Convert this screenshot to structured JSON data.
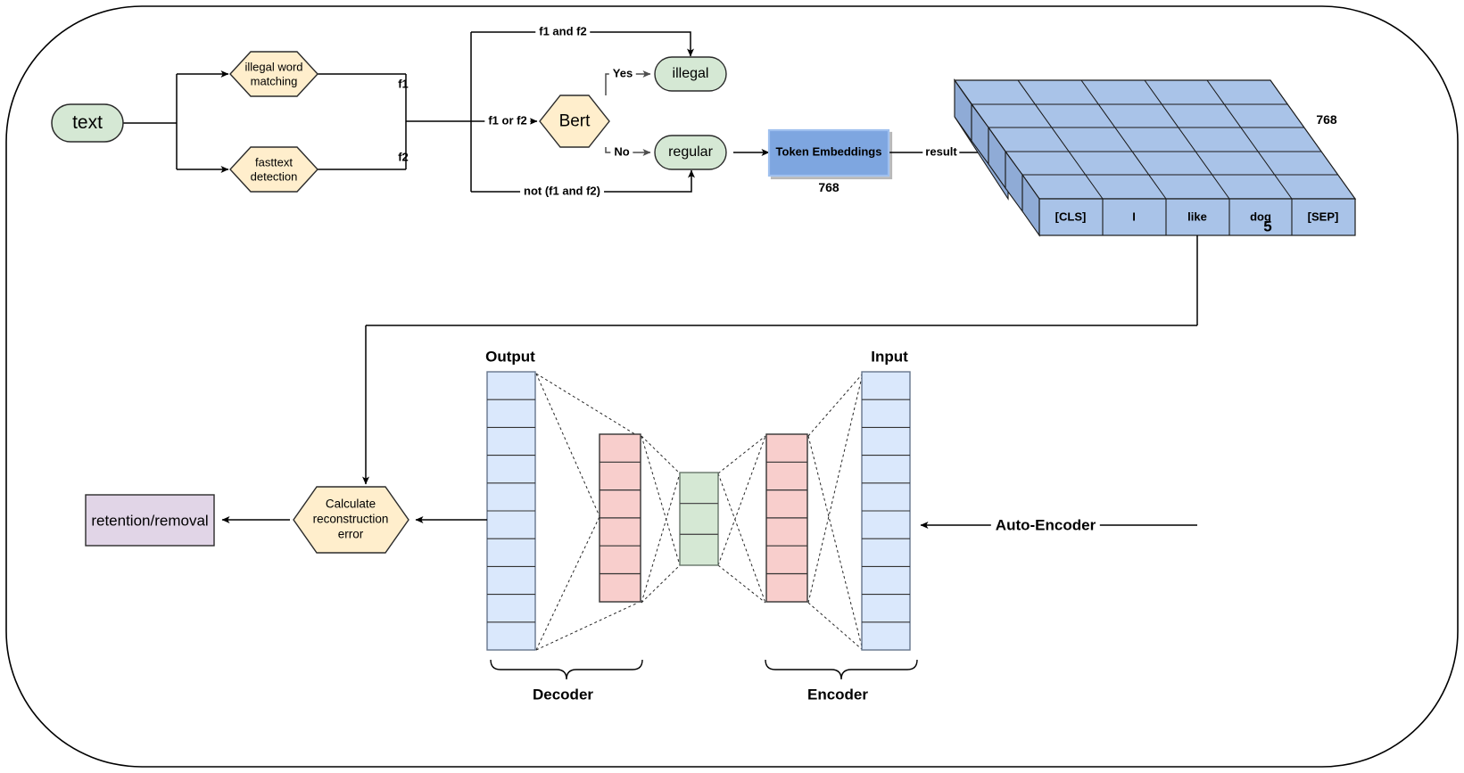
{
  "diagram": {
    "title": "Illegal text detection and auto-encoder pipeline",
    "colors": {
      "green_fill": "#d5e8d4",
      "green_stroke": "#82b366",
      "yellow_fill": "#ffe6cc",
      "yellow_stroke": "#d79b00",
      "blue_fill": "#dae8fc",
      "blue_stroke": "#6c8ebf",
      "blue_strong_fill": "#7ea6e0",
      "pink_fill": "#f8cecc",
      "pink_stroke": "#b85450",
      "purple_fill": "#e1d5e7",
      "purple_stroke": "#9673a6",
      "cube_fill": "#9cb9e0",
      "cube_top_fill": "#a6c0e4",
      "cube_face_fill": "#a9c3e8",
      "stroke": "#000000"
    }
  },
  "nodes": {
    "text": "text",
    "illegal_word_matching": "illegal word\nmatching",
    "illegal_word_matching_line1": "illegal word",
    "illegal_word_matching_line2": "matching",
    "fasttext_detection_line1": "fasttext",
    "fasttext_detection_line2": "detection",
    "bert": "Bert",
    "illegal": "illegal",
    "regular": "regular",
    "token_embeddings": "Token Embeddings",
    "retention_removal": "retention/removal",
    "calculate_line1": "Calculate",
    "calculate_line2": "reconstruction",
    "calculate_line3": "error"
  },
  "edge_labels": {
    "f1": "f1",
    "f2": "f2",
    "f1_and_f2": "f1 and f2",
    "f1_or_f2": "f1 or f2",
    "not_f1_and_f2": "not (f1 and f2)",
    "yes": "Yes",
    "no": "No",
    "result": "result",
    "auto_encoder": "Auto-Encoder"
  },
  "dimensions": {
    "token_embeddings_dim": "768",
    "cube_depth_dim": "768",
    "cube_width_dim": "5"
  },
  "cube": {
    "tokens": [
      "[CLS]",
      "I",
      "like",
      "dog",
      "[SEP]"
    ],
    "rows": 5,
    "depth_label": "768",
    "width_label": "5"
  },
  "autoencoder": {
    "output_label": "Output",
    "input_label": "Input",
    "decoder_label": "Decoder",
    "encoder_label": "Encoder",
    "layers": {
      "output_cells": 10,
      "decoder_hidden_cells": 6,
      "bottleneck_cells": 3,
      "encoder_hidden_cells": 6,
      "input_cells": 10
    }
  }
}
